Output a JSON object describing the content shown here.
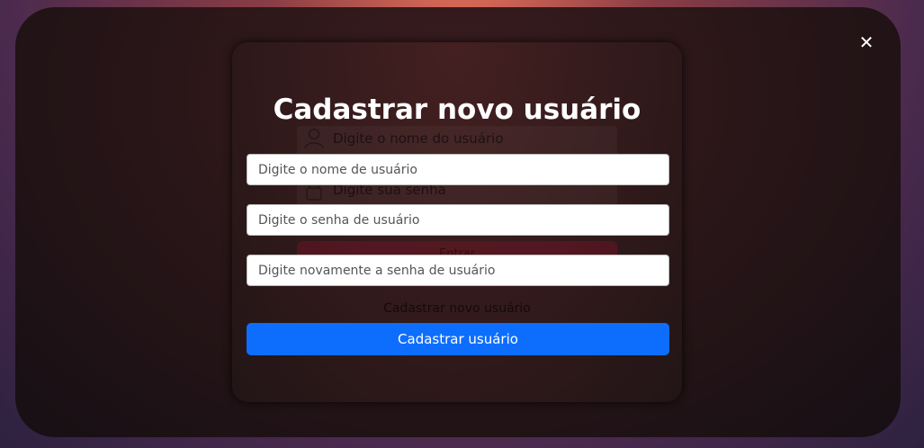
{
  "close": {
    "symbol": "✕"
  },
  "background_form": {
    "username_placeholder": "Digite o nome do usuário",
    "password_placeholder": "Digite sua senha",
    "login_button": "Entrar",
    "register_link": "Cadastrar novo usuário"
  },
  "modal": {
    "title": "Cadastrar novo usuário",
    "username_placeholder": "Digite o nome de usuário",
    "password_placeholder": "Digite o senha de usuário",
    "password_confirm_placeholder": "Digite novamente a senha de usuário",
    "submit_label": "Cadastrar usuário"
  },
  "colors": {
    "primary_button": "#0d6efd",
    "title_text": "#ffffff"
  },
  "icons": [
    "close-icon",
    "user-icon",
    "lock-icon"
  ]
}
